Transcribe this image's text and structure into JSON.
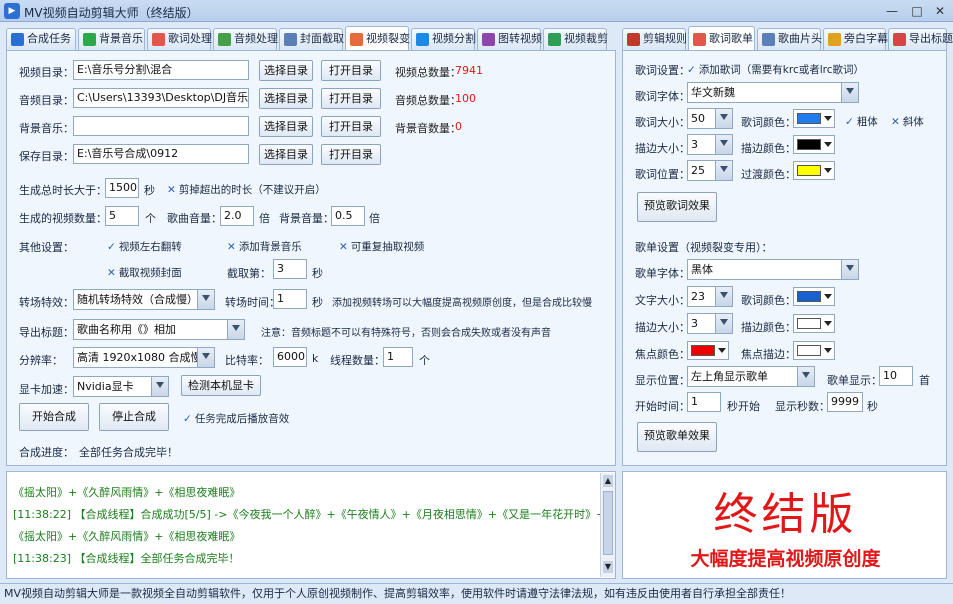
{
  "window": {
    "title": "MV视频自动剪辑大师（终结版）",
    "app_icon": "film-icon"
  },
  "left_tabs": [
    {
      "label": "合成任务",
      "icon": "play-icon"
    },
    {
      "label": "背景音乐",
      "icon": "music-icon"
    },
    {
      "label": "歌词处理",
      "icon": "lyrics-icon"
    },
    {
      "label": "音频处理",
      "icon": "audio-wave-icon"
    },
    {
      "label": "封面截取",
      "icon": "image-icon"
    },
    {
      "label": "视频裂变",
      "icon": "copy-icon",
      "active": true
    },
    {
      "label": "视频分割",
      "icon": "video-icon"
    },
    {
      "label": "图转视频",
      "icon": "picture-icon"
    },
    {
      "label": "视频裁剪",
      "icon": "crop-icon"
    }
  ],
  "right_tabs": [
    {
      "label": "剪辑规则",
      "icon": "ruler-icon"
    },
    {
      "label": "歌词歌单",
      "icon": "text-icon",
      "active": true
    },
    {
      "label": "歌曲片头",
      "icon": "picture-icon"
    },
    {
      "label": "旁白字幕",
      "icon": "subtitle-icon"
    },
    {
      "label": "导出标题",
      "icon": "export-icon"
    }
  ],
  "dirs": [
    {
      "label": "视频目录：",
      "value": "E:\\音乐号分割\\混合",
      "count_label": "视频总数量：",
      "count": "7941"
    },
    {
      "label": "音频目录：",
      "value": "C:\\Users\\13393\\Desktop\\DJ音乐合集",
      "count_label": "音频总数量：",
      "count": "100"
    },
    {
      "label": "背景音乐：",
      "value": "",
      "count_label": "背景音数量：",
      "count": "0"
    },
    {
      "label": "保存目录：",
      "value": "E:\\音乐号合成\\0912",
      "count_label": "",
      "count": ""
    }
  ],
  "buttons": {
    "choose_dir": "选择目录",
    "open_dir": "打开目录",
    "detect_gpu": "检测本机显卡",
    "start": "开始合成",
    "stop": "停止合成",
    "preview_lyrics": "预览歌词效果",
    "preview_playlist": "预览歌单效果"
  },
  "form": {
    "total_duration_label": "生成总时长大于：",
    "total_duration": "1500",
    "sec": "秒",
    "cut_excess": "剪掉超出的时长（不建议开启）",
    "video_count_label": "生成的视频数量：",
    "video_count": "5",
    "unit_ge": "个",
    "song_vol_label": "歌曲音量：",
    "song_vol": "2.0",
    "bg_vol_label": "背景音量：",
    "bg_vol": "0.5",
    "unit_bei": "倍",
    "other_label": "其他设置：",
    "opt_flip": "视频左右翻转",
    "opt_bg_music": "添加背景音乐",
    "opt_repeat": "可重复抽取视频",
    "opt_cover": "截取视频封面",
    "cover_frames_label": "截取第：",
    "cover_frames": "3",
    "transition_label": "转场特效：",
    "transition": "随机转场特效（合成慢）",
    "transition_time_label": "转场时间：",
    "transition_time": "1",
    "transition_note": "添加视频转场可以大幅度提高视频原创度，但是合成比较慢",
    "export_title_label": "导出标题：",
    "export_title": "歌曲名称用《》相加",
    "export_note": "注意：音频标题不可以有特殊符号，否则会合成失败或者没有声音",
    "resolution_label": "分辨率：",
    "resolution": "高清 1920x1080 合成慢",
    "bitrate_label": "比特率：",
    "bitrate": "6000",
    "bitrate_unit": "k",
    "threads_label": "线程数量：",
    "threads": "1",
    "gpu_label": "显卡加速：",
    "gpu": "Nvidia显卡",
    "play_sound": "任务完成后播放音效",
    "progress_label": "合成进度：",
    "progress_text": "全部任务合成完毕！"
  },
  "lyrics": {
    "section": "歌词设置：",
    "add_lyrics": "添加歌词（需要有krc或者lrc歌词）",
    "font_label": "歌词字体：",
    "font": "华文新魏",
    "size_label": "歌词大小：",
    "size": "50",
    "color_label": "歌词颜色：",
    "color": "#1e7cf0",
    "bold": "粗体",
    "italic": "斜体",
    "stroke_label": "描边大小：",
    "stroke": "3",
    "stroke_color_label": "描边颜色：",
    "stroke_color": "#000000",
    "pos_label": "歌词位置：",
    "pos": "25",
    "trans_color_label": "过渡颜色：",
    "trans_color": "#ffff00"
  },
  "playlist": {
    "section": "歌单设置（视频裂变专用）：",
    "font_label": "歌单字体：",
    "font": "黑体",
    "text_size_label": "文字大小：",
    "text_size": "23",
    "color_label": "歌词颜色：",
    "color": "#1660d0",
    "stroke_label": "描边大小：",
    "stroke": "3",
    "stroke_color_label": "描边颜色：",
    "stroke_color": "#ffffff",
    "focus_color_label": "焦点颜色：",
    "focus_color": "#ee0000",
    "focus_stroke_label": "焦点描边：",
    "focus_stroke": "#ffffff",
    "display_pos_label": "显示位置：",
    "display_pos": "左上角显示歌单",
    "show_count_label": "歌单显示：",
    "show_count": "10",
    "unit_shou": "首",
    "start_label": "开始时间：",
    "start": "1",
    "start_unit": "秒开始",
    "show_secs_label": "显示秒数：",
    "show_secs": "9999",
    "sec": "秒"
  },
  "log": [
    {
      "text": "《摇太阳》+《久醉风雨情》+《相思夜难眠》",
      "color": "#1b7d1b"
    },
    {
      "text": "[11:38:22] 【合成线程】合成成功[5/5] ->《今夜我一个人醉》+《午夜情人》+《月夜相思情》+《又是一年花开时》+",
      "color": "#1b7d1b"
    },
    {
      "text": "《摇太阳》+《久醉风雨情》+《相思夜难眠》",
      "color": "#1b7d1b"
    },
    {
      "text": "[11:38:23] 【合成线程】全部任务合成完毕！",
      "color": "#1b7d1b"
    }
  ],
  "promo": {
    "title": "终结版",
    "subtitle": "大幅度提高视频原创度"
  },
  "status": "MV视频自动剪辑大师是一款视频全自动剪辑软件，仅用于个人原创视频制作、提高剪辑效率，使用软件时请遵守法律法规，如有违反由使用者自行承担全部责任！"
}
